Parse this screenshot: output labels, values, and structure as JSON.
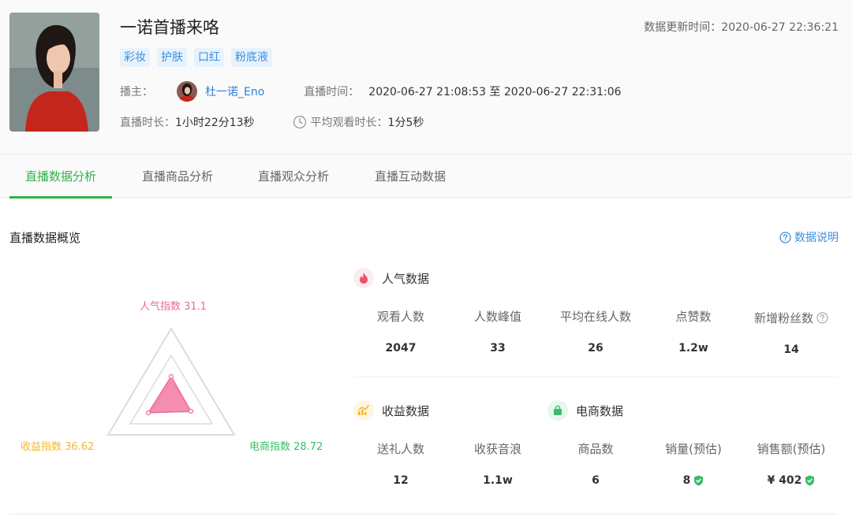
{
  "header": {
    "title": "一诺首播来咯",
    "update_label": "数据更新时间：",
    "update_time": "2020-06-27 22:36:21",
    "tags": [
      "彩妆",
      "护肤",
      "口红",
      "粉底液"
    ],
    "host_label": "播主：",
    "host_name": "杜一诺_Eno",
    "live_time_label": "直播时间：",
    "live_time_value": "2020-06-27 21:08:53 至 2020-06-27 22:31:06",
    "duration_label": "直播时长：",
    "duration_value": "1小时22分13秒",
    "avg_watch_label": "平均观看时长：",
    "avg_watch_value": "1分5秒"
  },
  "tabs": [
    {
      "label": "直播数据分析",
      "active": true
    },
    {
      "label": "直播商品分析",
      "active": false
    },
    {
      "label": "直播观众分析",
      "active": false
    },
    {
      "label": "直播互动数据",
      "active": false
    }
  ],
  "overview": {
    "title": "直播数据概览",
    "help_label": "数据说明"
  },
  "radar": {
    "popularity": "人气指数 31.1",
    "revenue": "收益指数 36.62",
    "ecommerce": "电商指数 28.72",
    "colors": {
      "popularity": "#f06a98",
      "revenue": "#f5b72b",
      "ecommerce": "#3dbb6a"
    }
  },
  "popularity_group": {
    "title": "人气数据",
    "metrics": [
      {
        "label": "观看人数",
        "value": "2047"
      },
      {
        "label": "人数峰值",
        "value": "33"
      },
      {
        "label": "平均在线人数",
        "value": "26"
      },
      {
        "label": "点赞数",
        "value": "1.2w"
      },
      {
        "label": "新增粉丝数",
        "value": "14"
      }
    ]
  },
  "revenue_group": {
    "title": "收益数据",
    "metrics": [
      {
        "label": "送礼人数",
        "value": "12"
      },
      {
        "label": "收获音浪",
        "value": "1.1w"
      }
    ]
  },
  "ecommerce_group": {
    "title": "电商数据",
    "metrics": [
      {
        "label": "商品数",
        "value": "6"
      },
      {
        "label": "销量(预估)",
        "value": "8"
      },
      {
        "label": "销售额(预估)",
        "value": "¥ 402"
      }
    ]
  }
}
